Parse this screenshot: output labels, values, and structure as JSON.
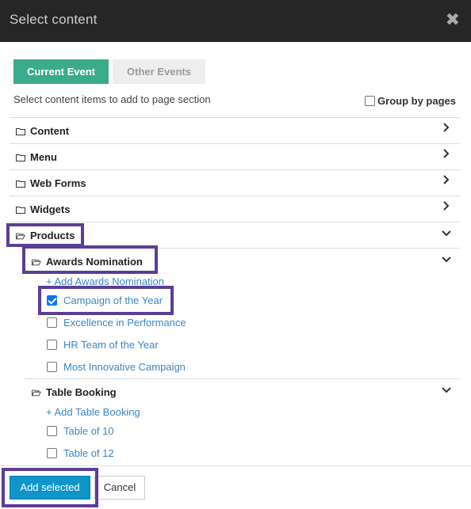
{
  "dialog": {
    "title": "Select content",
    "close_symbol": "✖"
  },
  "tabs": [
    {
      "label": "Current Event",
      "active": true
    },
    {
      "label": "Other Events",
      "active": false
    }
  ],
  "instructions": "Select content items to add to page section",
  "group_by_pages": {
    "label": "Group by pages",
    "checked": false
  },
  "tree": {
    "content": "Content",
    "menu": "Menu",
    "web_forms": "Web Forms",
    "widgets": "Widgets",
    "products": "Products",
    "awards": {
      "label": "Awards Nomination",
      "add_link": "+ Add Awards Nomination",
      "items": [
        {
          "label": "Campaign of the Year",
          "checked": true
        },
        {
          "label": "Excellence in Performance",
          "checked": false
        },
        {
          "label": "HR Team of the Year",
          "checked": false
        },
        {
          "label": "Most Innovative Campaign",
          "checked": false
        }
      ]
    },
    "table_booking": {
      "label": "Table Booking",
      "add_link": "+ Add Table Booking",
      "items": [
        {
          "label": "Table of 10",
          "checked": false
        },
        {
          "label": "Table of 12",
          "checked": false
        }
      ]
    }
  },
  "footer": {
    "add_selected": "Add selected",
    "cancel": "Cancel"
  },
  "colors": {
    "header": "#262626",
    "tab_active": "#3aab8b",
    "primary": "#0f95c9",
    "link": "#3a87c4",
    "highlight": "#5b3e96"
  }
}
